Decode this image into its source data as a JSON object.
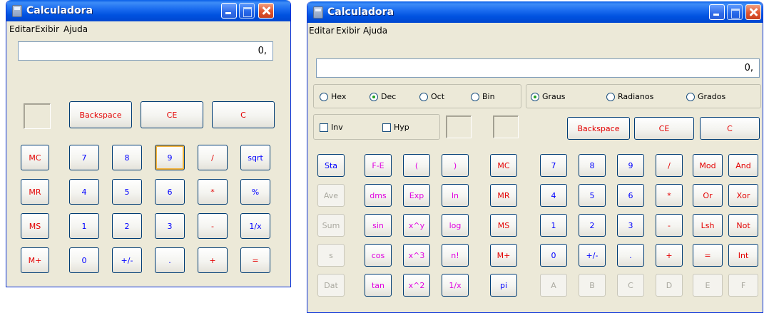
{
  "standard": {
    "title": "Calculadora",
    "menu": [
      "Editar",
      "Exibir",
      "Ajuda"
    ],
    "display": "0,",
    "controls": {
      "backspace": "Backspace",
      "ce": "CE",
      "c": "C"
    },
    "memory": [
      "MC",
      "MR",
      "MS",
      "M+"
    ],
    "rows": [
      [
        "7",
        "8",
        "9",
        "/",
        "sqrt"
      ],
      [
        "4",
        "5",
        "6",
        "*",
        "%"
      ],
      [
        "1",
        "2",
        "3",
        "-",
        "1/x"
      ],
      [
        "0",
        "+/-",
        ".",
        "+",
        "="
      ]
    ]
  },
  "scientific": {
    "title": "Calculadora",
    "menu": [
      "Editar",
      "Exibir",
      "Ajuda"
    ],
    "display": "0,",
    "bases": [
      "Hex",
      "Dec",
      "Oct",
      "Bin"
    ],
    "base_selected": "Dec",
    "angles": [
      "Graus",
      "Radianos",
      "Grados"
    ],
    "angle_selected": "Graus",
    "checks": [
      "Inv",
      "Hyp"
    ],
    "controls": {
      "backspace": "Backspace",
      "ce": "CE",
      "c": "C"
    },
    "stat": [
      "Sta",
      "Ave",
      "Sum",
      "s",
      "Dat"
    ],
    "func": [
      [
        "F-E",
        "(",
        ")"
      ],
      [
        "dms",
        "Exp",
        "ln"
      ],
      [
        "sin",
        "x^y",
        "log"
      ],
      [
        "cos",
        "x^3",
        "n!"
      ],
      [
        "tan",
        "x^2",
        "1/x"
      ]
    ],
    "memory": [
      "MC",
      "MR",
      "MS",
      "M+",
      "pi"
    ],
    "rows": [
      [
        "7",
        "8",
        "9",
        "/",
        "Mod",
        "And"
      ],
      [
        "4",
        "5",
        "6",
        "*",
        "Or",
        "Xor"
      ],
      [
        "1",
        "2",
        "3",
        "-",
        "Lsh",
        "Not"
      ],
      [
        "0",
        "+/-",
        ".",
        "+",
        "=",
        "Int"
      ],
      [
        "A",
        "B",
        "C",
        "D",
        "E",
        "F"
      ]
    ]
  }
}
